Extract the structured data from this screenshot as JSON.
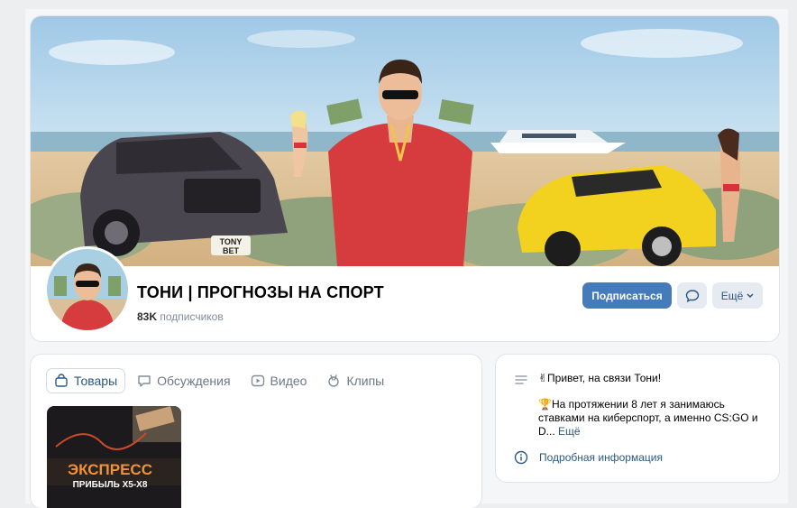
{
  "group": {
    "title": "ТОНИ | ПРОГНОЗЫ НА СПОРТ",
    "subscribers_count": "83K",
    "subscribers_label": "подписчиков",
    "cover_plate_line1": "TONY",
    "cover_plate_line2": "BET"
  },
  "actions": {
    "subscribe_label": "Подписаться",
    "more_label": "Ещё"
  },
  "tabs": [
    {
      "label": "Товары",
      "icon": "bag-icon",
      "active": true
    },
    {
      "label": "Обсуждения",
      "icon": "chat-icon",
      "active": false
    },
    {
      "label": "Видео",
      "icon": "play-icon",
      "active": false
    },
    {
      "label": "Клипы",
      "icon": "clips-icon",
      "active": false
    }
  ],
  "product": {
    "title_line1": "ЭКСПРЕСС",
    "title_line2": "ПРИБЫЛЬ Х5-Х8"
  },
  "info": {
    "greeting": "✌Привет, на связи Тони!",
    "about": "🏆На протяжении 8 лет я занимаюсь ставками на киберспорт, а именно CS:GO и D...",
    "more_link": "Ещё",
    "details_link": "Подробная информация"
  },
  "colors": {
    "accent": "#447bba",
    "link": "#2a5885",
    "secondary_button": "#e6ebf2"
  }
}
